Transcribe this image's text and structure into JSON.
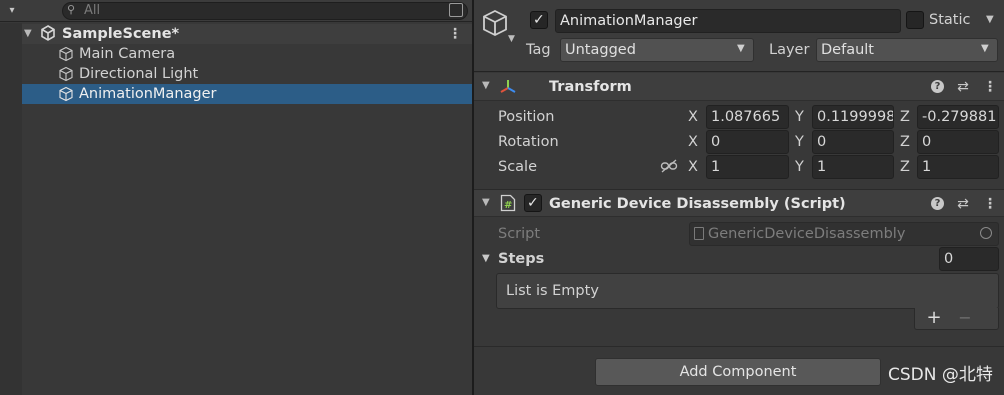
{
  "hierarchy": {
    "search_placeholder": "All",
    "scene_name": "SampleScene*",
    "items": [
      {
        "label": "Main Camera",
        "selected": false
      },
      {
        "label": "Directional Light",
        "selected": false
      },
      {
        "label": "AnimationManager",
        "selected": true
      }
    ]
  },
  "inspector": {
    "object_name": "AnimationManager",
    "active_checked": true,
    "static_label": "Static",
    "tag_label": "Tag",
    "tag_value": "Untagged",
    "layer_label": "Layer",
    "layer_value": "Default",
    "transform": {
      "title": "Transform",
      "position_label": "Position",
      "rotation_label": "Rotation",
      "scale_label": "Scale",
      "axis_x": "X",
      "axis_y": "Y",
      "axis_z": "Z",
      "position": {
        "x": "1.087665",
        "y": "0.1199998",
        "z": "-0.279881"
      },
      "rotation": {
        "x": "0",
        "y": "0",
        "z": "0"
      },
      "scale": {
        "x": "1",
        "y": "1",
        "z": "1"
      }
    },
    "script_component": {
      "title": "Generic Device Disassembly (Script)",
      "enabled": true,
      "script_label": "Script",
      "script_value": "GenericDeviceDisassembly",
      "steps_label": "Steps",
      "steps_count": "0",
      "list_empty_text": "List is Empty",
      "add_symbol": "+",
      "remove_symbol": "−"
    },
    "add_component_label": "Add Component"
  },
  "watermark": "CSDN @北特",
  "colors": {
    "selection": "#2c5d87",
    "panel_bg": "#383838",
    "header_bg": "#3e3e3e"
  }
}
